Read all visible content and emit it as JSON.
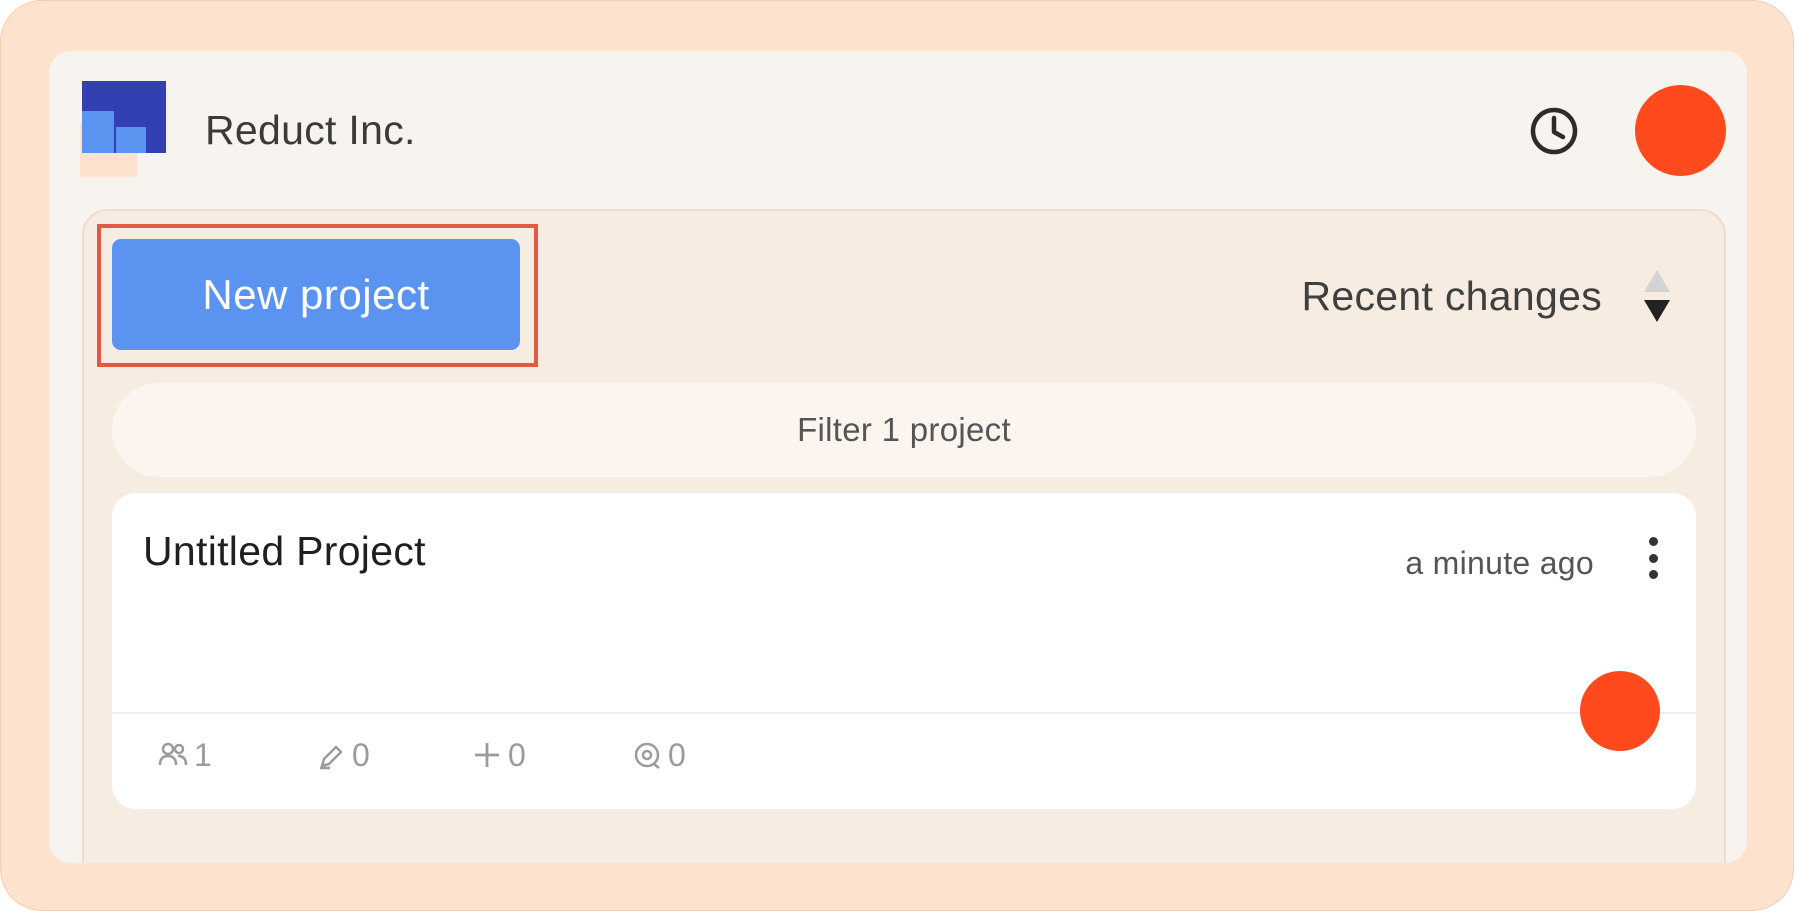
{
  "header": {
    "org_name": "Reduct Inc.",
    "logo_icon": "reduct-logo-icon",
    "history_icon": "clock-history-icon",
    "avatar_color": "#ff4a1d"
  },
  "toolbar": {
    "new_project_label": "New project",
    "sort_label": "Recent changes",
    "sort_icon": "sort-toggle-icon"
  },
  "filter": {
    "placeholder": "Filter 1 project"
  },
  "projects": [
    {
      "title": "Untitled Project",
      "modified": "a minute ago",
      "menu_icon": "kebab-menu-icon",
      "owner_avatar_color": "#ff4a1d",
      "stats": {
        "members": "1",
        "edits": "0",
        "added": "0",
        "comments": "0"
      }
    }
  ],
  "colors": {
    "frame": "#fde2ce",
    "window": "#f7f3ef",
    "panel": "#f7ece2",
    "accent": "#5b93f0",
    "highlight": "#e05a44",
    "avatar": "#ff4a1d"
  }
}
